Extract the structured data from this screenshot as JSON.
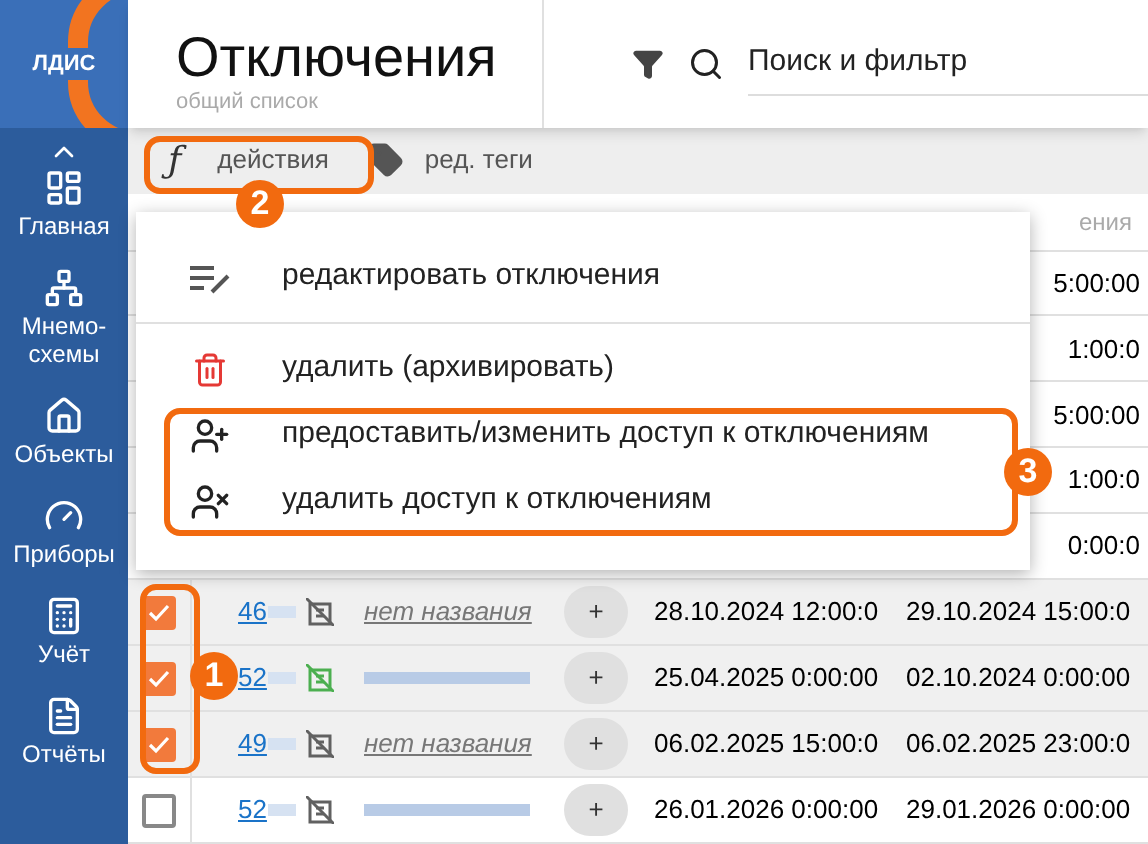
{
  "logo": {
    "text": "ЛДИС"
  },
  "sidebar": {
    "items": [
      {
        "label": "Главная"
      },
      {
        "label": "Мнемо-схемы"
      },
      {
        "label": "Объекты"
      },
      {
        "label": "Приборы"
      },
      {
        "label": "Учёт"
      },
      {
        "label": "Отчёты"
      }
    ]
  },
  "header": {
    "title": "Отключения",
    "subtitle": "общий список",
    "search": {
      "placeholder": "Поиск и фильтр"
    }
  },
  "toolbar": {
    "actions": {
      "icon": "ƒ",
      "label": "действия"
    },
    "tags": {
      "label": "ред. теги"
    }
  },
  "table": {
    "header_fragment": "ения",
    "hidden_rows": [
      {
        "end": "5:00:00"
      },
      {
        "end": "1:00:0"
      },
      {
        "end": "5:00:00"
      },
      {
        "end": "1:00:0"
      },
      {
        "end": "0:00:0"
      }
    ],
    "rows": [
      {
        "checked": true,
        "id": "46",
        "name": "нет названия",
        "color": "#616161",
        "add": "+",
        "start": "28.10.2024 12:00:0",
        "end": "29.10.2024 15:00:0"
      },
      {
        "checked": true,
        "id": "52",
        "color": "#4caf50",
        "add": "+",
        "start": "25.04.2025 0:00:00",
        "end": "02.10.2024 0:00:00"
      },
      {
        "checked": true,
        "id": "49",
        "name": "нет названия",
        "color": "#616161",
        "add": "+",
        "start": "06.02.2025 15:00:0",
        "end": "06.02.2025 23:00:0"
      },
      {
        "checked": false,
        "id": "52",
        "color": "#616161",
        "add": "+",
        "start": "26.01.2026 0:00:00",
        "end": "29.01.2026 0:00:00"
      }
    ]
  },
  "menu": {
    "items": [
      {
        "kind": "edit",
        "label": "редактировать отключения"
      },
      {
        "kind": "delete",
        "label": "удалить (архивировать)"
      },
      {
        "kind": "grant",
        "label": "предоставить/изменить доступ к отключениям"
      },
      {
        "kind": "revoke",
        "label": "удалить доступ к отключениям"
      }
    ]
  },
  "annotations": [
    {
      "label": "2"
    },
    {
      "label": "1"
    },
    {
      "label": "3"
    }
  ]
}
